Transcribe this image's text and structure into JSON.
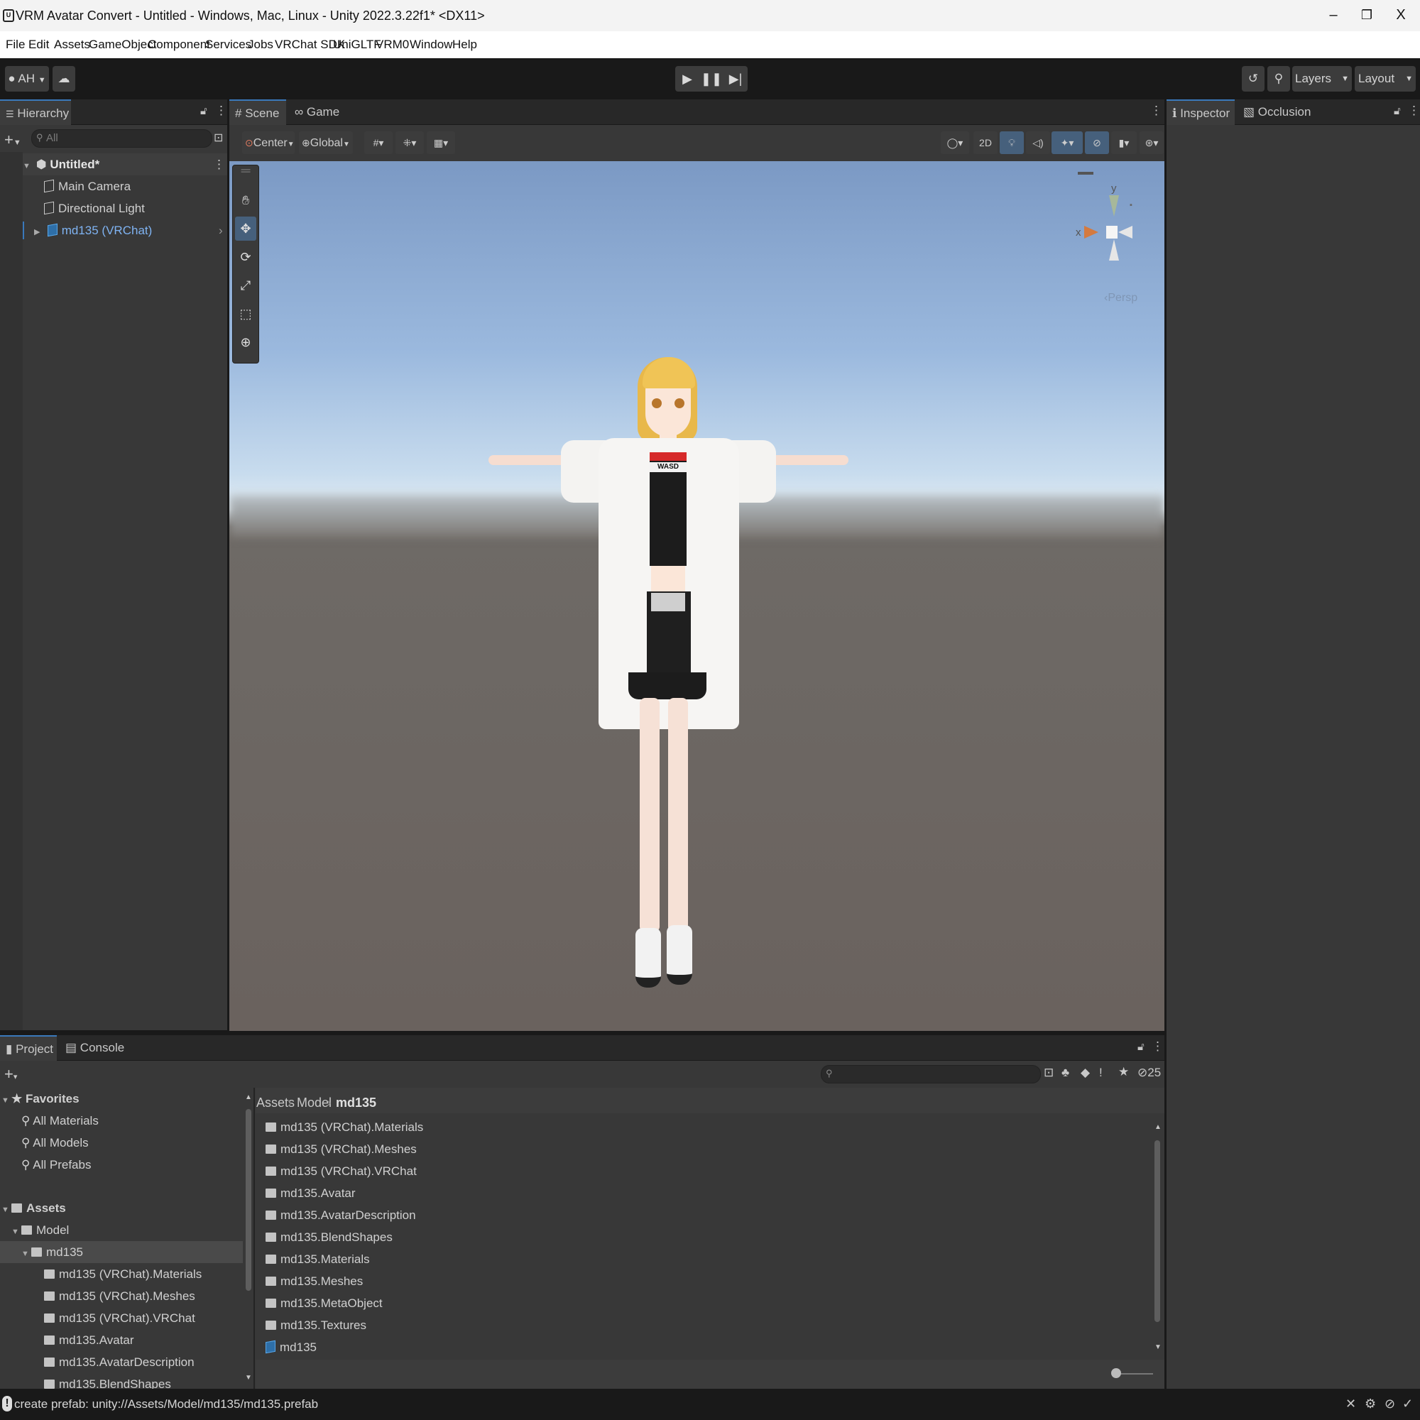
{
  "window": {
    "title": "VRM Avatar Convert - Untitled - Windows, Mac, Linux - Unity 2022.3.22f1* <DX11>",
    "minimize": "–",
    "restore": "❐",
    "close": "X"
  },
  "menu": [
    "File",
    "Edit",
    "Assets",
    "GameObject",
    "Component",
    "Services",
    "Jobs",
    "VRChat SDK",
    "UniGLTF",
    "VRM0",
    "Window",
    "Help"
  ],
  "toolbar": {
    "account": "AH",
    "layers": "Layers",
    "layout": "Layout"
  },
  "hierarchy": {
    "tab": "Hierarchy",
    "search_placeholder": "All",
    "scene": "Untitled*",
    "items": [
      "Main Camera",
      "Directional Light",
      "md135 (VRChat)"
    ]
  },
  "scene_view": {
    "tabs": [
      "Scene",
      "Game"
    ],
    "pivot": "Center",
    "space": "Global",
    "mode_2d": "2D",
    "gizmo": {
      "y": "y",
      "x": "x",
      "proj": "Persp"
    },
    "shirt_text": "WASD"
  },
  "inspector": {
    "tabs": [
      "Inspector",
      "Occlusion"
    ]
  },
  "project": {
    "tabs": [
      "Project",
      "Console"
    ],
    "hidden_count": "25",
    "favorites": {
      "label": "Favorites",
      "items": [
        "All Materials",
        "All Models",
        "All Prefabs"
      ]
    },
    "assets_label": "Assets",
    "tree": {
      "model": "Model",
      "md135": "md135",
      "children": [
        "md135 (VRChat).Materials",
        "md135 (VRChat).Meshes",
        "md135 (VRChat).VRChat",
        "md135.Avatar",
        "md135.AvatarDescription",
        "md135.BlendShapes"
      ]
    },
    "breadcrumb": [
      "Assets",
      "Model",
      "md135"
    ],
    "files": [
      "md135 (VRChat).Materials",
      "md135 (VRChat).Meshes",
      "md135 (VRChat).VRChat",
      "md135.Avatar",
      "md135.AvatarDescription",
      "md135.BlendShapes",
      "md135.Materials",
      "md135.Meshes",
      "md135.MetaObject",
      "md135.Textures",
      "md135"
    ]
  },
  "status": {
    "message": "create prefab: unity://Assets/Model/md135/md135.prefab"
  },
  "colors": {
    "accent": "#3a79bb",
    "selected_text": "#7fb3f2",
    "panel": "#383838"
  }
}
